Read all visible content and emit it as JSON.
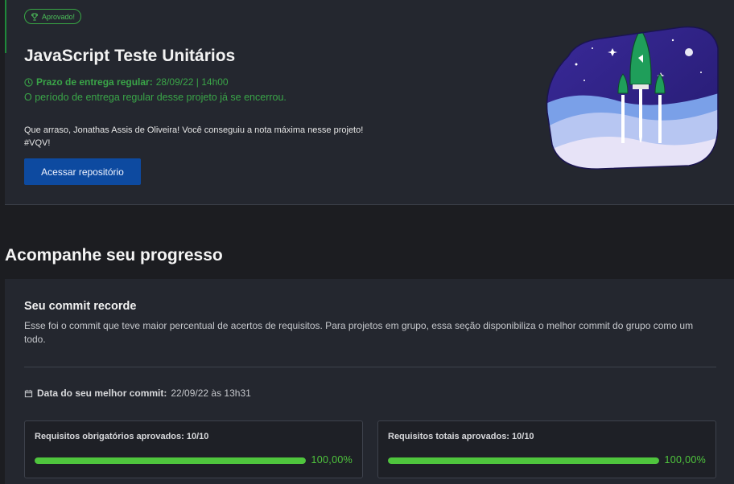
{
  "project": {
    "badge": "Aprovado!",
    "title": "JavaScript Teste Unitários",
    "deadline_label": "Prazo de entrega regular:",
    "deadline_value": "28/09/22 | 14h00",
    "closed_message": "O período de entrega regular desse projeto já se encerrou.",
    "congrats_line1": "Que arraso, Jonathas Assis de Oliveira! Você conseguiu a nota máxima nesse projeto!",
    "congrats_line2": "#VQV!",
    "repo_button": "Acessar repositório"
  },
  "progress": {
    "heading": "Acompanhe seu progresso",
    "commit_title": "Seu commit recorde",
    "commit_desc": "Esse foi o commit que teve maior percentual de acertos de requisitos. Para projetos em grupo, essa seção disponibiliza o melhor commit do grupo como um todo.",
    "best_commit_label": "Data do seu melhor commit:",
    "best_commit_value": "22/09/22 às 13h31",
    "requirements": [
      {
        "label": "Requisitos obrigatórios aprovados: 10/10",
        "percent_text": "100,00%",
        "fraction": 1.0
      },
      {
        "label": "Requisitos totais aprovados: 10/10",
        "percent_text": "100,00%",
        "fraction": 1.0
      }
    ]
  },
  "colors": {
    "success": "#4fc53d",
    "primary_button": "#0d4aa0",
    "card_bg": "#24272f",
    "page_bg": "#1c1d21"
  },
  "icons": [
    "trophy-icon",
    "clock-icon",
    "calendar-icon",
    "rocket-illustration"
  ]
}
